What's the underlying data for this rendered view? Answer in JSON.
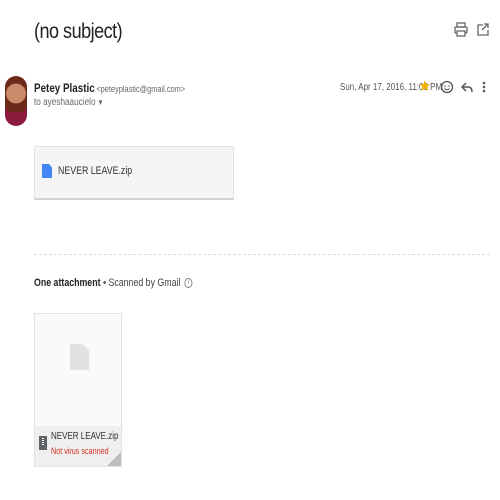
{
  "email": {
    "subject": "(no subject)",
    "sender_name": "Petey Plastic",
    "sender_email": "<peteyplastic@gmail.com>",
    "recipient": "to ayeshaaucielo",
    "date": "Sun, Apr 17, 2016, 11:03 PM"
  },
  "icons": {
    "print": "print-icon",
    "new_window": "open-in-new-window-icon",
    "star": "star-icon",
    "emoji": "emoji-reaction-icon",
    "reply": "reply-icon",
    "more": "more-vertical-icon",
    "star_color": "#f4b400"
  },
  "inline_attachment": {
    "name": "NEVER LEAVE.zip"
  },
  "attachments": {
    "count_label": "One attachment",
    "separator": "•",
    "scanned_label": "Scanned by Gmail",
    "info_symbol": "i",
    "items": [
      {
        "name": "NEVER LEAVE.zip",
        "status": "Not virus scanned"
      }
    ],
    "warning_color": "#d93025"
  }
}
